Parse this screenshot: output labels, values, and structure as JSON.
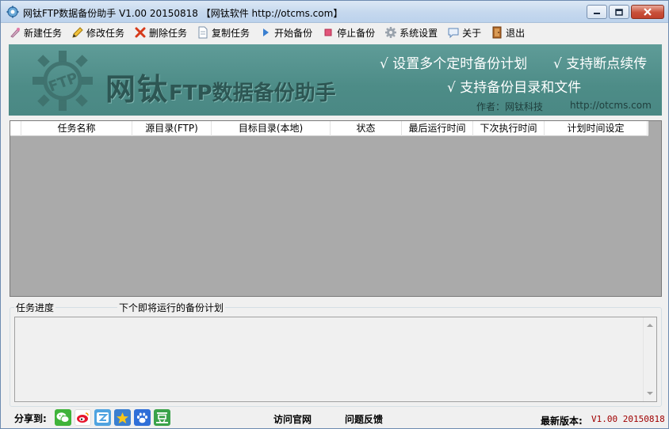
{
  "window": {
    "title": "网钛FTP数据备份助手 V1.00 20150818 【网钛软件 http://otcms.com】"
  },
  "toolbar": {
    "items": [
      {
        "label": "新建任务",
        "icon": "new-task-icon"
      },
      {
        "label": "修改任务",
        "icon": "pencil-icon"
      },
      {
        "label": "删除任务",
        "icon": "delete-x-icon"
      },
      {
        "label": "复制任务",
        "icon": "copy-document-icon"
      },
      {
        "label": "开始备份",
        "icon": "play-icon"
      },
      {
        "label": "停止备份",
        "icon": "stop-icon"
      },
      {
        "label": "系统设置",
        "icon": "gear-icon"
      },
      {
        "label": "关于",
        "icon": "speech-bubble-icon"
      },
      {
        "label": "退出",
        "icon": "exit-door-icon"
      }
    ]
  },
  "banner": {
    "title_big": "网钛",
    "title_small": "FTP数据备份助手",
    "feature1": "√ 设置多个定时备份计划",
    "feature2": "√ 支持断点续传",
    "feature3": "√ 支持备份目录和文件",
    "author": "作者：网钛科技",
    "url": "http://otcms.com",
    "logo_text": "FTP",
    "colors": {
      "bg": "#4d8c87",
      "title": "#2d5653",
      "feature": "#ffffff"
    }
  },
  "grid": {
    "columns": [
      "任务名称",
      "源目录(FTP)",
      "目标目录(本地)",
      "状态",
      "最后运行时间",
      "下次执行时间",
      "计划时间设定"
    ],
    "rows": []
  },
  "progress": {
    "label_progress": "任务进度",
    "label_next": "下个即将运行的备份计划"
  },
  "statusbar": {
    "share_label": "分享到:",
    "share_icons": [
      "wechat-icon",
      "weibo-icon",
      "qq-zone-icon",
      "favorites-star-icon",
      "baidu-paw-icon",
      "douban-icon"
    ],
    "visit_site": "访问官网",
    "feedback": "问题反馈",
    "version_label": "最新版本:",
    "version_value": "V1.00 20150818"
  }
}
